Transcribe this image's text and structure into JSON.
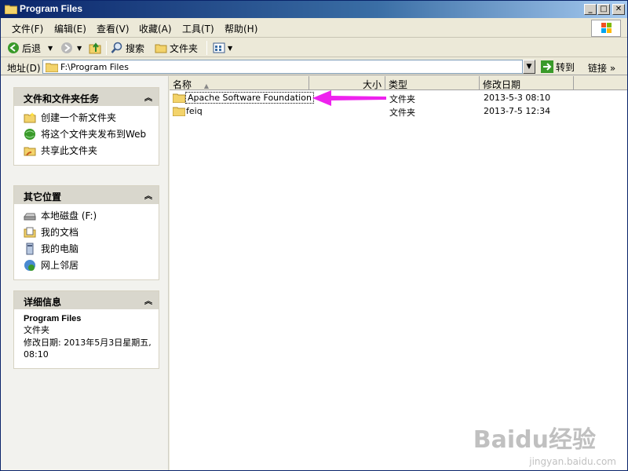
{
  "window": {
    "title": "Program Files"
  },
  "menu": [
    "文件(F)",
    "编辑(E)",
    "查看(V)",
    "收藏(A)",
    "工具(T)",
    "帮助(H)"
  ],
  "toolbar": {
    "back": "后退",
    "search": "搜索",
    "folders": "文件夹"
  },
  "address": {
    "label": "地址(D)",
    "value": "F:\\Program Files",
    "go": "转到",
    "links": "链接"
  },
  "tasks": {
    "header": "文件和文件夹任务",
    "items": [
      "创建一个新文件夹",
      "将这个文件夹发布到Web",
      "共享此文件夹"
    ]
  },
  "other_places": {
    "header": "其它位置",
    "items": [
      "本地磁盘 (F:)",
      "我的文档",
      "我的电脑",
      "网上邻居"
    ]
  },
  "details": {
    "header": "详细信息",
    "name": "Program Files",
    "type": "文件夹",
    "modified": "修改日期: 2013年5月3日星期五, 08:10"
  },
  "columns": [
    "名称",
    "大小",
    "类型",
    "修改日期"
  ],
  "files": [
    {
      "name": "Apache Software Foundation",
      "size": "",
      "type": "文件夹",
      "modified": "2013-5-3 08:10"
    },
    {
      "name": "feiq",
      "size": "",
      "type": "文件夹",
      "modified": "2013-7-5 12:34"
    }
  ],
  "colors": {
    "titlebar": "#0a246a",
    "arrow": "#ee22ee"
  },
  "watermark": {
    "logo": "Baidu经验",
    "url": "jingyan.baidu.com"
  }
}
